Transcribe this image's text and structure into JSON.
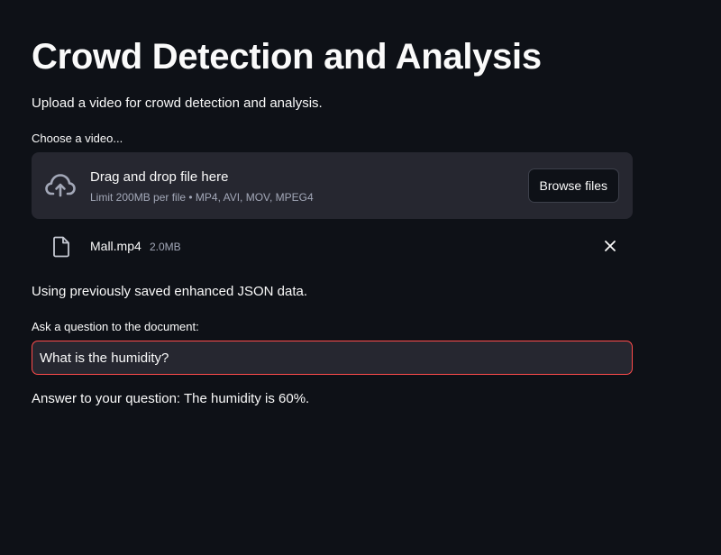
{
  "header": {
    "title": "Crowd Detection and Analysis",
    "subtitle": "Upload a video for crowd detection and analysis."
  },
  "uploader": {
    "label": "Choose a video...",
    "drop_text": "Drag and drop file here",
    "limit_text": "Limit 200MB per file • MP4, AVI, MOV, MPEG4",
    "browse_label": "Browse files",
    "icon": "cloud-upload-icon"
  },
  "uploaded_file": {
    "name": "Mall.mp4",
    "size": "2.0MB",
    "icon": "file-icon",
    "remove_icon": "close-icon"
  },
  "status": {
    "message": "Using previously saved enhanced JSON data."
  },
  "question": {
    "label": "Ask a question to the document:",
    "value": "What is the humidity?"
  },
  "answer": {
    "text": "Answer to your question: The humidity is 60%."
  },
  "colors": {
    "background": "#0e1117",
    "panel": "#262730",
    "accent": "#ff4b4b",
    "muted_text": "#a3a8b8"
  }
}
